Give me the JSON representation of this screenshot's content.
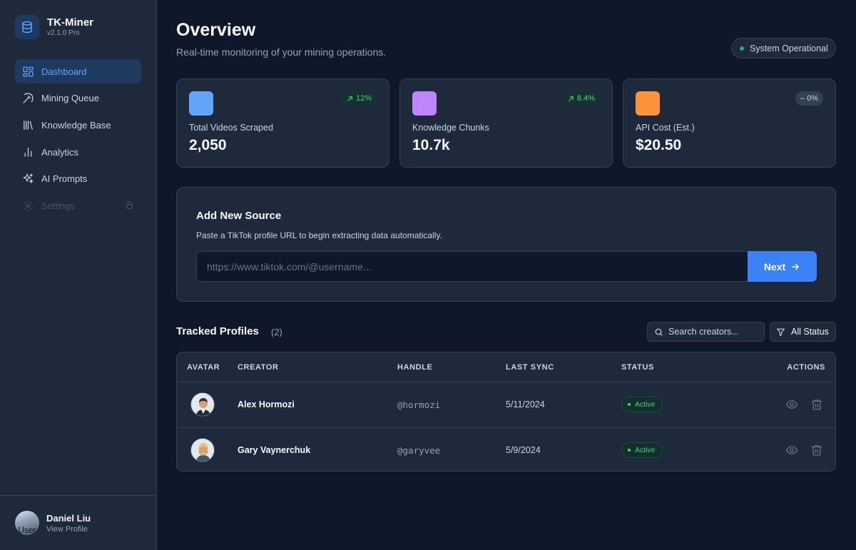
{
  "app": {
    "name": "TK-Miner",
    "version": "v2.1.0 Pro"
  },
  "sidebar": {
    "items": [
      {
        "label": "Dashboard",
        "icon": "dashboard-icon",
        "active": true
      },
      {
        "label": "Mining Queue",
        "icon": "pickaxe-icon"
      },
      {
        "label": "Knowledge Base",
        "icon": "library-icon"
      },
      {
        "label": "Analytics",
        "icon": "bar-chart-icon"
      },
      {
        "label": "AI Prompts",
        "icon": "sparkles-icon"
      },
      {
        "label": "Settings",
        "icon": "gear-icon",
        "disabled": true,
        "locked": true
      }
    ]
  },
  "user": {
    "name": "Daniel Liu",
    "link": "View Profile",
    "avatar_text": "User"
  },
  "header": {
    "title": "Overview",
    "subtitle": "Real-time monitoring of your mining operations.",
    "status": "System Operational"
  },
  "stats": [
    {
      "label": "Total Videos Scraped",
      "value": "2,050",
      "trend": "12%",
      "trend_type": "up",
      "color": "#60a5fa"
    },
    {
      "label": "Knowledge Chunks",
      "value": "10.7k",
      "trend": "8.4%",
      "trend_type": "up",
      "color": "#c084fc"
    },
    {
      "label": "API Cost (Est.)",
      "value": "$20.50",
      "trend": "0%",
      "trend_type": "flat",
      "color": "#fb923c"
    }
  ],
  "add_source": {
    "title": "Add New Source",
    "description": "Paste a TikTok profile URL to begin extracting data automatically.",
    "placeholder": "https://www.tiktok.com/@username...",
    "button": "Next"
  },
  "profiles": {
    "title": "Tracked Profiles",
    "count": "(2)",
    "search_placeholder": "Search creators...",
    "filter_label": "All Status",
    "columns": [
      "AVATAR",
      "CREATOR",
      "HANDLE",
      "LAST SYNC",
      "STATUS",
      "ACTIONS"
    ],
    "rows": [
      {
        "creator": "Alex Hormozi",
        "handle": "@hormozi",
        "last_sync": "5/11/2024",
        "status": "Active"
      },
      {
        "creator": "Gary Vaynerchuk",
        "handle": "@garyvee",
        "last_sync": "5/9/2024",
        "status": "Active"
      }
    ]
  }
}
